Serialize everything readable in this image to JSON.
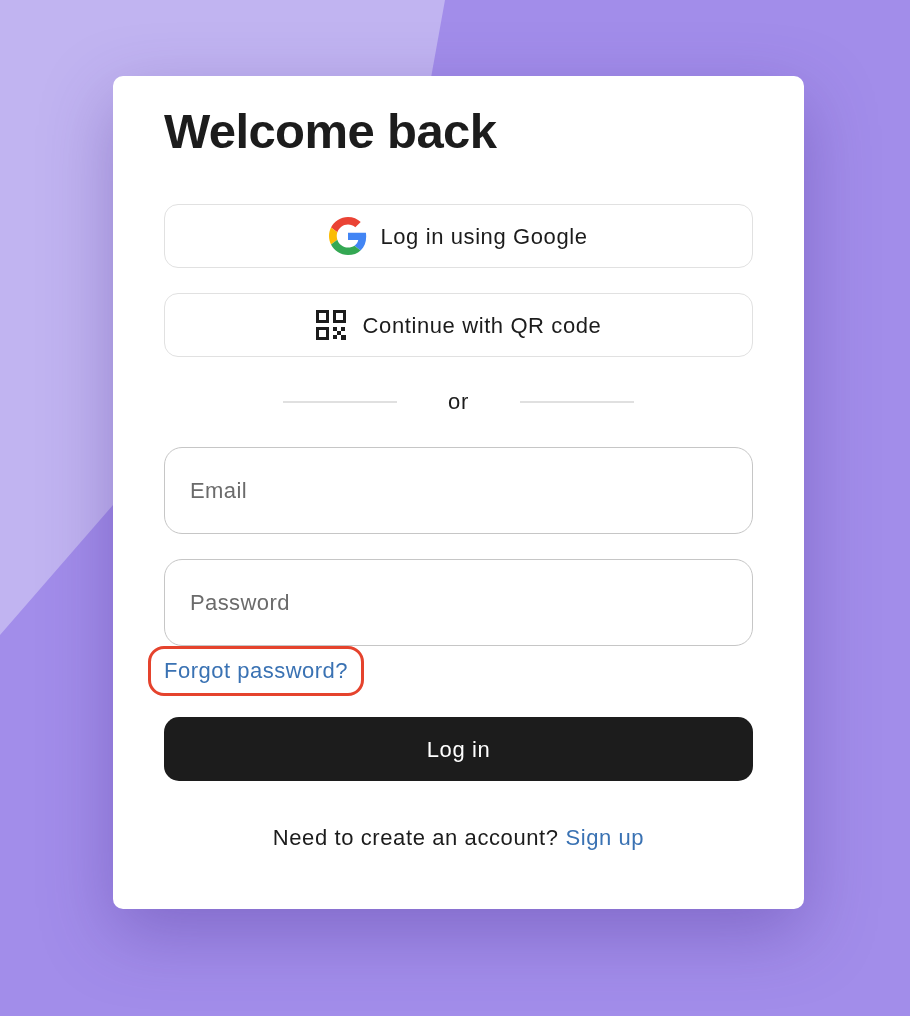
{
  "heading": "Welcome back",
  "social_buttons": [
    {
      "kind": "google",
      "label": "Log in using Google"
    },
    {
      "kind": "qr",
      "label": "Continue with QR code"
    }
  ],
  "divider": {
    "label": "or"
  },
  "fields": [
    {
      "placeholder": "Email"
    },
    {
      "placeholder": "Password"
    }
  ],
  "forgot_link": {
    "label": "Forgot password?",
    "highlighted": true
  },
  "submit_button": {
    "label": "Log in"
  },
  "footer": {
    "text": "Need to create an account?",
    "link": "Sign up"
  }
}
